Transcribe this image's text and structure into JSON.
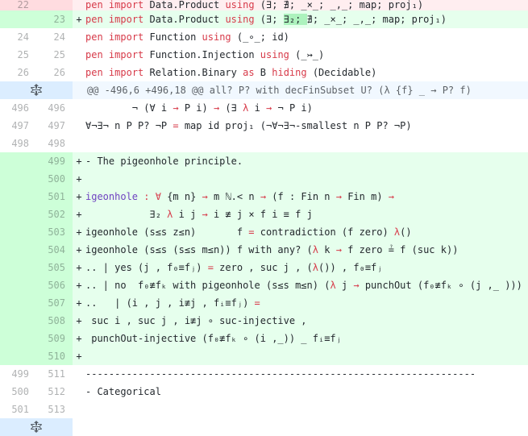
{
  "colors": {
    "added_bg": "#e6ffed",
    "added_gutter": "#cdffd8",
    "hunk_bg": "#f1f8ff",
    "keyword": "#d73a49",
    "entity": "#6f42c1"
  },
  "hunk_label": "@@ -496,6 +496,18 @@ all? P? with decFinSubset U? (λ {f} _ → P? f)",
  "icons": [
    "unfold-icon"
  ],
  "rows": [
    {
      "type": "del",
      "old": "22",
      "new": "",
      "marker": "",
      "segments": [
        {
          "t": "pen",
          "c": "kw"
        },
        {
          "t": " "
        },
        {
          "t": "import",
          "c": "kw"
        },
        {
          "t": " Data.Product "
        },
        {
          "t": "using",
          "c": "kw"
        },
        {
          "t": " (∃; ∄; _×_; _,_; map; proj₁)"
        }
      ]
    },
    {
      "type": "add",
      "old": "",
      "new": "23",
      "marker": "+",
      "segments": [
        {
          "t": "pen",
          "c": "kw"
        },
        {
          "t": " "
        },
        {
          "t": "import",
          "c": "kw"
        },
        {
          "t": " Data.Product "
        },
        {
          "t": "using",
          "c": "kw"
        },
        {
          "t": " (∃; "
        },
        {
          "t": "∃₂; ",
          "c": "hl"
        },
        {
          "t": "∄; _×_; _,_; map; proj₁)"
        }
      ]
    },
    {
      "type": "ctx",
      "old": "24",
      "new": "24",
      "marker": "",
      "segments": [
        {
          "t": "pen",
          "c": "kw"
        },
        {
          "t": " "
        },
        {
          "t": "import",
          "c": "kw"
        },
        {
          "t": " Function "
        },
        {
          "t": "using",
          "c": "kw"
        },
        {
          "t": " (_∘_; id)"
        }
      ]
    },
    {
      "type": "ctx",
      "old": "25",
      "new": "25",
      "marker": "",
      "segments": [
        {
          "t": "pen",
          "c": "kw"
        },
        {
          "t": " "
        },
        {
          "t": "import",
          "c": "kw"
        },
        {
          "t": " Function.Injection "
        },
        {
          "t": "using",
          "c": "kw"
        },
        {
          "t": " (_↣_)"
        }
      ]
    },
    {
      "type": "ctx",
      "old": "26",
      "new": "26",
      "marker": "",
      "segments": [
        {
          "t": "pen",
          "c": "kw"
        },
        {
          "t": " "
        },
        {
          "t": "import",
          "c": "kw"
        },
        {
          "t": " Relation.Binary "
        },
        {
          "t": "as",
          "c": "kw"
        },
        {
          "t": " B "
        },
        {
          "t": "hiding",
          "c": "kw"
        },
        {
          "t": " (Decidable)"
        }
      ]
    },
    {
      "type": "hunk"
    },
    {
      "type": "ctx",
      "old": "496",
      "new": "496",
      "marker": "",
      "segments": [
        {
          "t": "        ¬ (∀ i "
        },
        {
          "t": "→",
          "c": "kw"
        },
        {
          "t": " P i) "
        },
        {
          "t": "→",
          "c": "kw"
        },
        {
          "t": " (∃ "
        },
        {
          "t": "λ",
          "c": "kw"
        },
        {
          "t": " i "
        },
        {
          "t": "→",
          "c": "kw"
        },
        {
          "t": " ¬ P i)"
        }
      ]
    },
    {
      "type": "ctx",
      "old": "497",
      "new": "497",
      "marker": "",
      "segments": [
        {
          "t": "∀¬∃¬ n P P? ¬P "
        },
        {
          "t": "=",
          "c": "kw"
        },
        {
          "t": " map id proj₁ (¬∀¬∃¬-smallest n P P? ¬P)"
        }
      ]
    },
    {
      "type": "ctx",
      "old": "498",
      "new": "498",
      "marker": "",
      "segments": []
    },
    {
      "type": "add",
      "old": "",
      "new": "499",
      "marker": "+",
      "segments": [
        {
          "t": "- The pigeonhole principle."
        }
      ]
    },
    {
      "type": "add",
      "old": "",
      "new": "500",
      "marker": "+",
      "segments": []
    },
    {
      "type": "add",
      "old": "",
      "new": "501",
      "marker": "+",
      "segments": [
        {
          "t": "igeonhole",
          "c": "en"
        },
        {
          "t": " "
        },
        {
          "t": ":",
          "c": "kw"
        },
        {
          "t": " "
        },
        {
          "t": "∀",
          "c": "kw"
        },
        {
          "t": " {m n} "
        },
        {
          "t": "→",
          "c": "kw"
        },
        {
          "t": " m ℕ.< n "
        },
        {
          "t": "→",
          "c": "kw"
        },
        {
          "t": " (f : Fin n "
        },
        {
          "t": "→",
          "c": "kw"
        },
        {
          "t": " Fin m) "
        },
        {
          "t": "→",
          "c": "kw"
        }
      ]
    },
    {
      "type": "add",
      "old": "",
      "new": "502",
      "marker": "+",
      "segments": [
        {
          "t": "           ∃₂ "
        },
        {
          "t": "λ",
          "c": "kw"
        },
        {
          "t": " i j "
        },
        {
          "t": "→",
          "c": "kw"
        },
        {
          "t": " i ≢ j × f i ≡ f j"
        }
      ]
    },
    {
      "type": "add",
      "old": "",
      "new": "503",
      "marker": "+",
      "segments": [
        {
          "t": "igeonhole (s≤s z≤n)       f "
        },
        {
          "t": "=",
          "c": "kw"
        },
        {
          "t": " contradiction (f zero) "
        },
        {
          "t": "λ",
          "c": "kw"
        },
        {
          "t": "()"
        }
      ]
    },
    {
      "type": "add",
      "old": "",
      "new": "504",
      "marker": "+",
      "segments": [
        {
          "t": "igeonhole (s≤s (s≤s m≤n)) f with any? ("
        },
        {
          "t": "λ",
          "c": "kw"
        },
        {
          "t": " k "
        },
        {
          "t": "→",
          "c": "kw"
        },
        {
          "t": " f zero ≟ f (suc k))"
        }
      ]
    },
    {
      "type": "add",
      "old": "",
      "new": "505",
      "marker": "+",
      "segments": [
        {
          "t": ".. | yes (j , f₀≡fⱼ) "
        },
        {
          "t": "=",
          "c": "kw"
        },
        {
          "t": " zero , suc j , ("
        },
        {
          "t": "λ",
          "c": "kw"
        },
        {
          "t": "()) , f₀≡fⱼ"
        }
      ]
    },
    {
      "type": "add",
      "old": "",
      "new": "506",
      "marker": "+",
      "segments": [
        {
          "t": ".. | no  f₀≢fₖ with pigeonhole (s≤s m≤n) ("
        },
        {
          "t": "λ",
          "c": "kw"
        },
        {
          "t": " j "
        },
        {
          "t": "→",
          "c": "kw"
        },
        {
          "t": " punchOut (f₀≢fₖ ∘ (j ,_ )))"
        }
      ]
    },
    {
      "type": "add",
      "old": "",
      "new": "507",
      "marker": "+",
      "segments": [
        {
          "t": "..   | (i , j , i≢j , fᵢ≡fⱼ) "
        },
        {
          "t": "=",
          "c": "kw"
        }
      ]
    },
    {
      "type": "add",
      "old": "",
      "new": "508",
      "marker": "+",
      "segments": [
        {
          "t": " suc i , suc j , i≢j ∘ suc-injective ,"
        }
      ]
    },
    {
      "type": "add",
      "old": "",
      "new": "509",
      "marker": "+",
      "segments": [
        {
          "t": " punchOut-injective (f₀≢fₖ ∘ (i ,_)) _ fᵢ≡fⱼ"
        }
      ]
    },
    {
      "type": "add",
      "old": "",
      "new": "510",
      "marker": "+",
      "segments": []
    },
    {
      "type": "ctx",
      "old": "499",
      "new": "511",
      "marker": "",
      "segments": [
        {
          "t": "-------------------------------------------------------------------"
        }
      ]
    },
    {
      "type": "ctx",
      "old": "500",
      "new": "512",
      "marker": "",
      "segments": [
        {
          "t": "- Categorical"
        }
      ]
    },
    {
      "type": "ctx",
      "old": "501",
      "new": "513",
      "marker": "",
      "segments": []
    },
    {
      "type": "expander"
    }
  ]
}
